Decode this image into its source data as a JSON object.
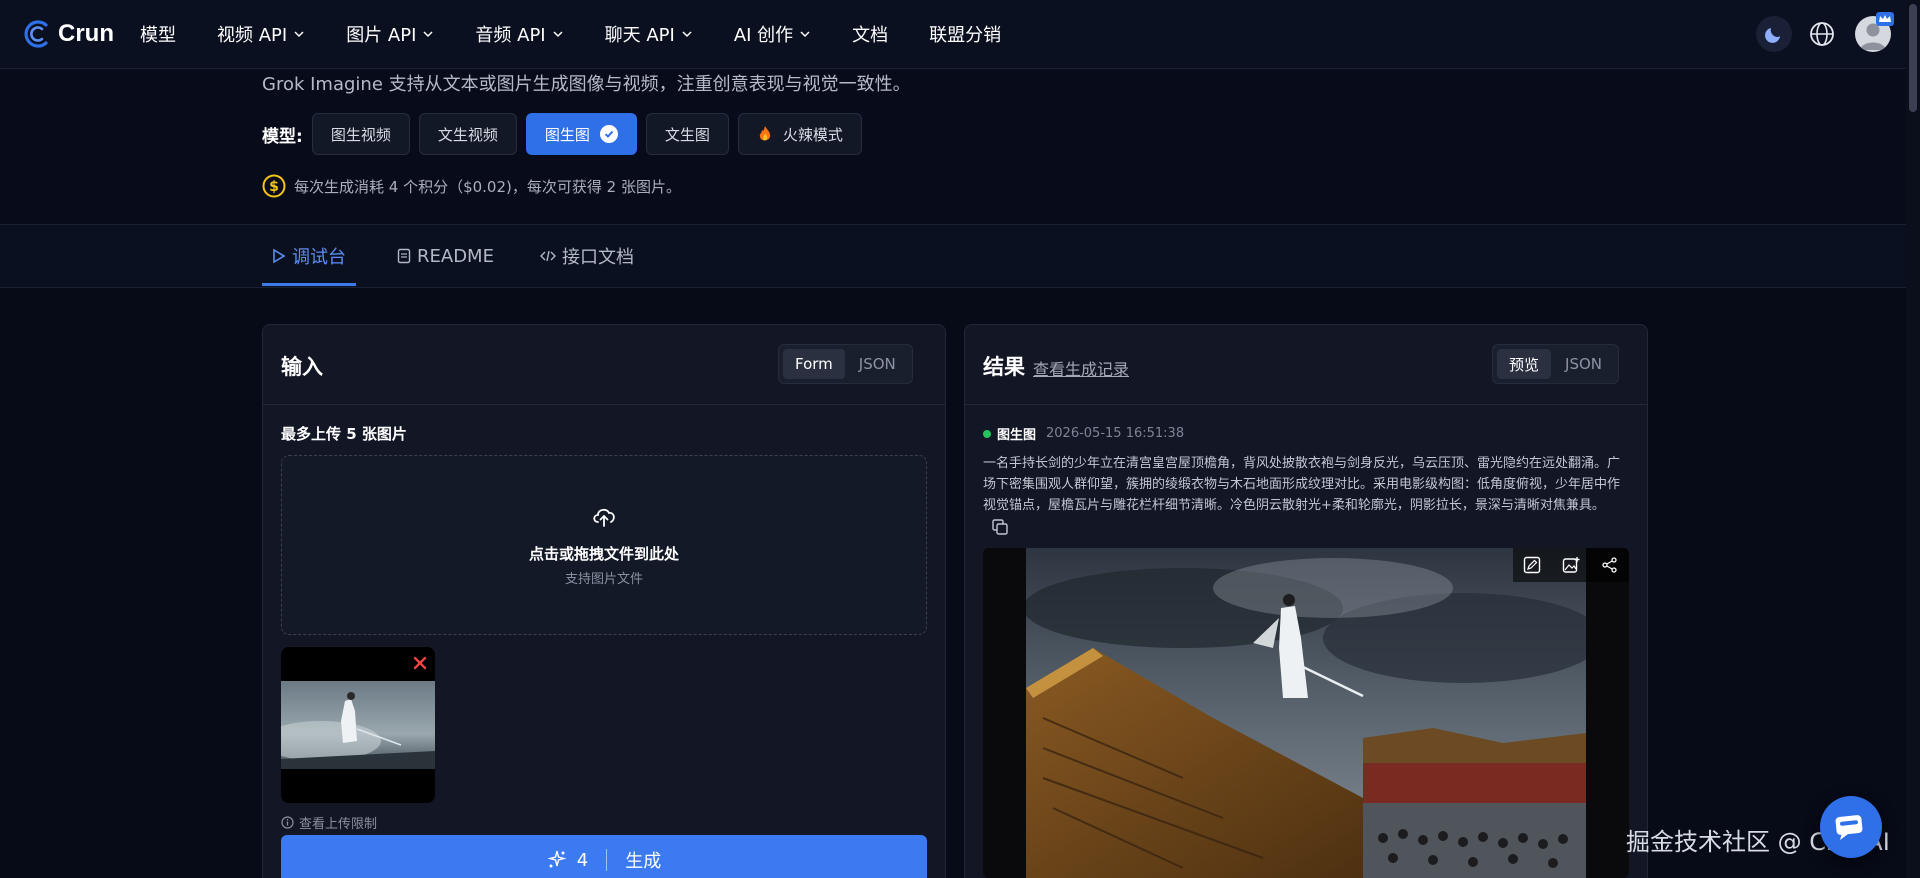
{
  "nav": {
    "brand": "Crun",
    "items": [
      {
        "label": "模型",
        "dropdown": false
      },
      {
        "label": "视频 API",
        "dropdown": true
      },
      {
        "label": "图片 API",
        "dropdown": true
      },
      {
        "label": "音频 API",
        "dropdown": true
      },
      {
        "label": "聊天 API",
        "dropdown": true
      },
      {
        "label": "AI 创作",
        "dropdown": true
      },
      {
        "label": "文档",
        "dropdown": false
      },
      {
        "label": "联盟分销",
        "dropdown": false
      }
    ]
  },
  "header": {
    "subtitle": "Grok Imagine 支持从文本或图片生成图像与视频，注重创意表现与视觉一致性。",
    "models_label": "模型:",
    "models": [
      {
        "label": "图生视频",
        "active": false
      },
      {
        "label": "文生视频",
        "active": false
      },
      {
        "label": "图生图",
        "active": true
      },
      {
        "label": "文生图",
        "active": false
      },
      {
        "label": "火辣模式",
        "active": false
      }
    ],
    "credit_text": "每次生成消耗 4 个积分（$0.02)，每次可获得 2 张图片。"
  },
  "tabs": [
    {
      "label": "调试台",
      "active": true
    },
    {
      "label": "README",
      "active": false
    },
    {
      "label": "接口文档",
      "active": false
    }
  ],
  "input_panel": {
    "title": "输入",
    "segments": [
      "Form",
      "JSON"
    ],
    "active_segment": "Form",
    "upload_label": "最多上传 5 张图片",
    "dropzone_main": "点击或拖拽文件到此处",
    "dropzone_sub": "支持图片文件",
    "limit_link": "查看上传限制",
    "generate_cost": "4",
    "generate_label": "生成"
  },
  "result_panel": {
    "title": "结果",
    "history_link": "查看生成记录",
    "segments": [
      "预览",
      "JSON"
    ],
    "active_segment": "预览",
    "tag": "图生图",
    "time": "2026-05-15 16:51:38",
    "prompt": "一名手持长剑的少年立在清宫皇宫屋顶檐角，背风处披散衣袍与剑身反光，乌云压顶、雷光隐约在远处翻涌。广场下密集围观人群仰望，簇拥的绫缎衣物与木石地面形成纹理对比。采用电影级构图：低角度俯视，少年居中作视觉锚点，屋檐瓦片与雕花栏杆细节清晰。冷色阴云散射光+柔和轮廓光，阴影拉长，景深与清晰对焦兼具。"
  },
  "watermark": "掘金技术社区 @ CrunAI",
  "colors": {
    "accent": "#3b7af0",
    "background": "#070a17",
    "panel": "#121625",
    "status_green": "#22c55e",
    "close_red": "#ef4444"
  }
}
